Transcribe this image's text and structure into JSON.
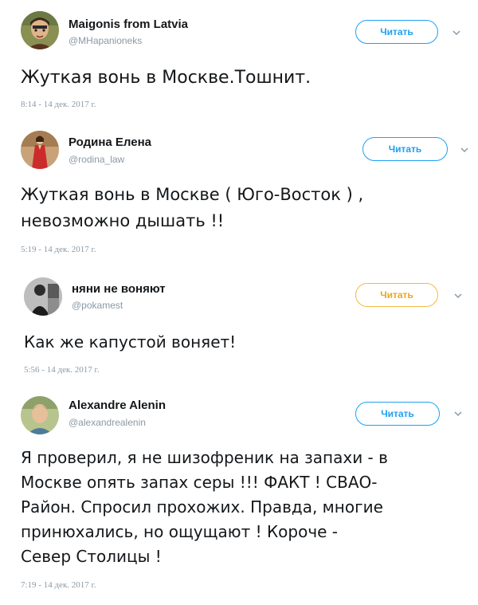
{
  "tweets": [
    {
      "name": "Maigonis from Latvia",
      "handle": "@MHapanioneks",
      "follow_label": "Читать",
      "text": "Жуткая вонь в Москве.Тошнит.",
      "timestamp": "8:14 - 14 дек. 2017 г.",
      "avatar_icon": "avatar-cartoon-portrait",
      "follow_color": "#1da1f2"
    },
    {
      "name": "Родина Елена",
      "handle": "@rodina_law",
      "follow_label": "Читать",
      "text": "Жуткая вонь в Москве ( Юго-Восток ) ,\nневозможно дышать !!",
      "timestamp": "5:19 - 14 дек. 2017 г.",
      "avatar_icon": "avatar-woman-red-dress",
      "follow_color": "#1da1f2"
    },
    {
      "name": "няни не воняют",
      "handle": "@pokamest",
      "follow_label": "Читать",
      "text": "Как же капустой воняет!",
      "timestamp": "5:56 - 14 дек. 2017 г.",
      "avatar_icon": "avatar-bw-photo",
      "follow_color": "#f3b945"
    },
    {
      "name": "Alexandre Alenin",
      "handle": "@alexandrealenin",
      "follow_label": "Читать",
      "text": "Я проверил, я не шизофреник на запахи - в\nМоскве опять запах серы !!! ФАКТ ! СВАО-\nРайон. Спросил прохожих. Правда, многие\nпринюхались, но ощущают ! Короче -\nСевер Столицы !",
      "timestamp": "7:19 - 14 дек. 2017 г.",
      "avatar_icon": "avatar-man-photo",
      "follow_color": "#1da1f2"
    }
  ]
}
